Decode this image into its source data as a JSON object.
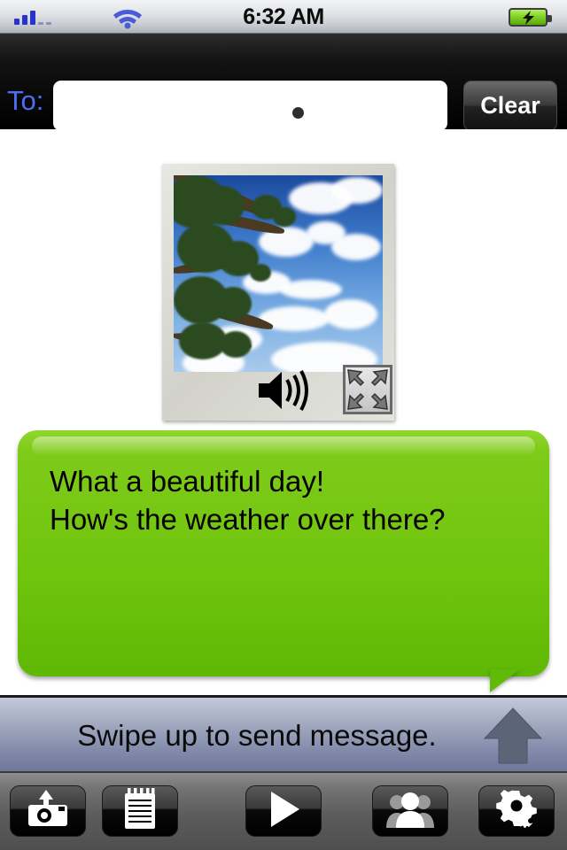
{
  "status_bar": {
    "time": "6:32 AM",
    "signal_bars_filled": 3,
    "signal_bars_empty": 2,
    "wifi_icon": "wifi-icon",
    "battery_icon": "battery-charging-icon",
    "battery_color": "#7ed321"
  },
  "compose": {
    "to_label": "To:",
    "to_value": "",
    "to_placeholder": "",
    "clear_label": "Clear",
    "page_dots": 2,
    "active_dot": 0
  },
  "attachment": {
    "type": "photo",
    "description": "polaroid photo of tree branches against blue cloudy sky",
    "speaker_icon": "speaker-icon",
    "expand_icon": "expand-arrows-icon"
  },
  "message": {
    "text": "What a beautiful day!\nHow's the weather over there?",
    "bubble_color": "#72c80f",
    "text_color": "#000000"
  },
  "swipe": {
    "label": "Swipe up to send message.",
    "arrow_icon": "arrow-up-icon"
  },
  "toolbar": {
    "buttons": [
      {
        "name": "camera-upload-button",
        "icon": "camera-upload-icon"
      },
      {
        "name": "notepad-button",
        "icon": "notepad-icon"
      },
      {
        "name": "play-button",
        "icon": "play-icon"
      },
      {
        "name": "contacts-button",
        "icon": "contacts-icon"
      },
      {
        "name": "settings-button",
        "icon": "gears-icon"
      }
    ]
  }
}
